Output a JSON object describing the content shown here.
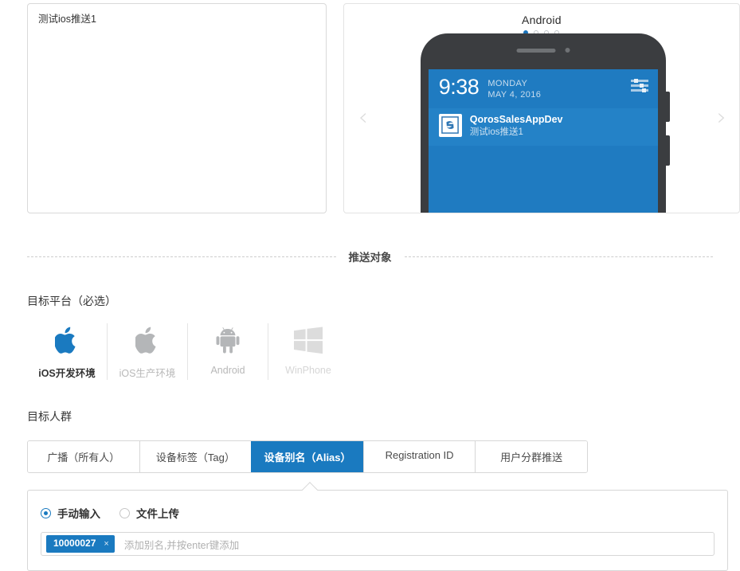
{
  "message_editor": {
    "content": "测试ios推送1"
  },
  "preview": {
    "title": "Android",
    "dots_total": 4,
    "dots_active_index": 0,
    "prev_arrow": "‹",
    "next_arrow": "›",
    "phone": {
      "status_time": "9:38",
      "status_weekday": "MONDAY",
      "status_date": "MAY 4, 2016",
      "notification": {
        "app_name": "QorosSalesAppDev",
        "body": "测试ios推送1"
      }
    }
  },
  "divider": {
    "label": "推送对象"
  },
  "target_platform": {
    "heading": "目标平台（必选）",
    "items": [
      {
        "label": "iOS开发环境",
        "icon": "apple-icon",
        "state": "selected"
      },
      {
        "label": "iOS生产环境",
        "icon": "apple-icon",
        "state": "dim"
      },
      {
        "label": "Android",
        "icon": "android-icon",
        "state": "dim"
      },
      {
        "label": "WinPhone",
        "icon": "windows-icon",
        "state": "dimmer"
      }
    ]
  },
  "target_audience": {
    "heading": "目标人群",
    "tabs": [
      {
        "label": "广播（所有人）",
        "active": false
      },
      {
        "label": "设备标签（Tag）",
        "active": false
      },
      {
        "label": "设备别名（Alias）",
        "active": true
      },
      {
        "label": "Registration ID",
        "active": false
      },
      {
        "label": "用户分群推送",
        "active": false
      }
    ]
  },
  "alias_panel": {
    "radios": [
      {
        "label": "手动输入",
        "checked": true
      },
      {
        "label": "文件上传",
        "checked": false
      }
    ],
    "tags": [
      {
        "value": "10000027",
        "remove": "×"
      }
    ],
    "placeholder": "添加别名,并按enter键添加"
  },
  "colors": {
    "accent_blue": "#1a7ac0",
    "screen_blue": "#1f7bc1",
    "notif_blue": "#2482c7",
    "phone_body": "#3b3d40"
  }
}
